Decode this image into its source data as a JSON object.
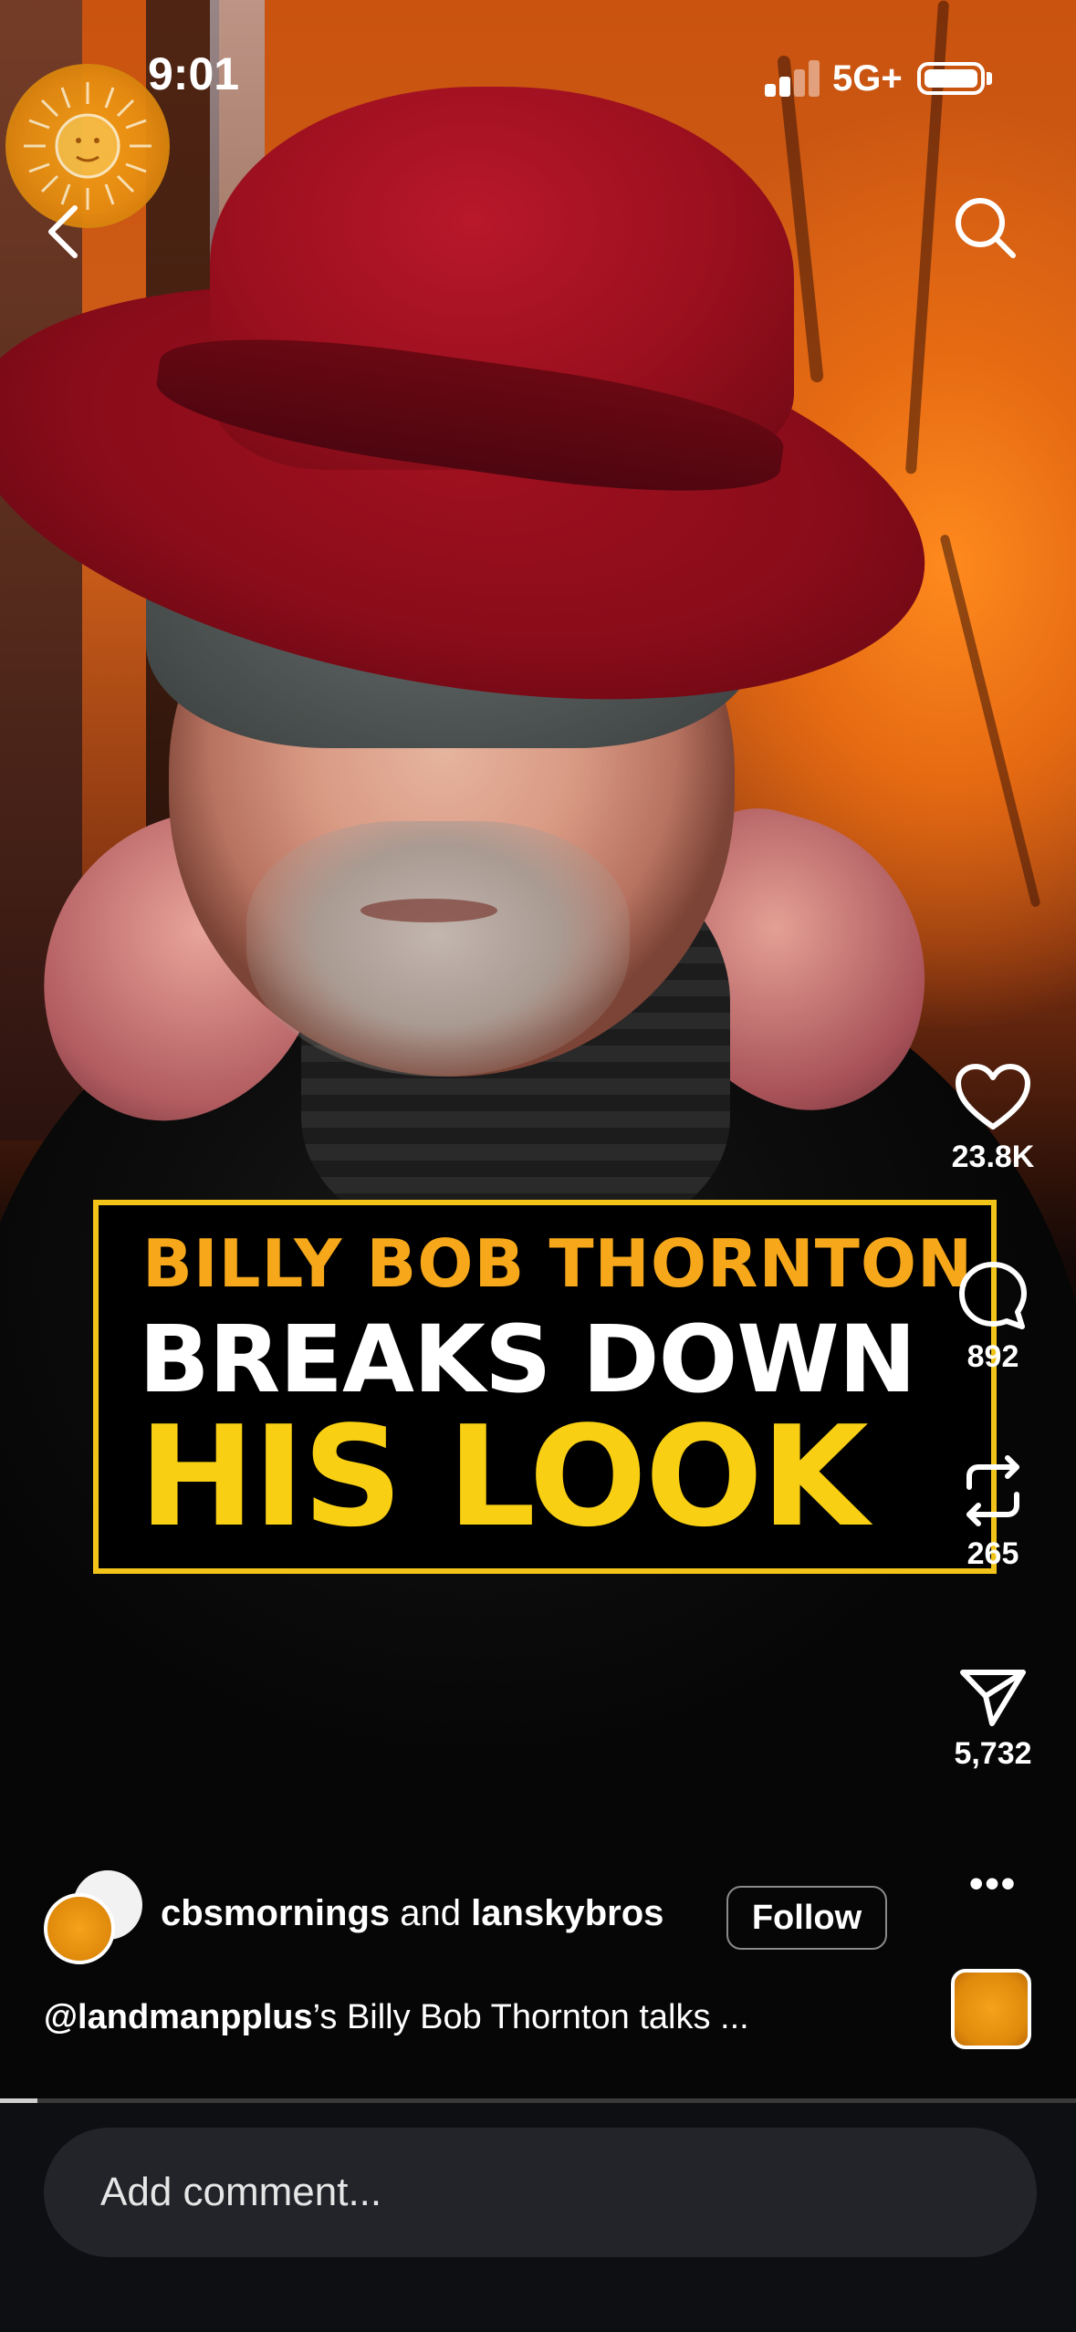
{
  "status_bar": {
    "time": "9:01",
    "network": "5G+"
  },
  "video": {
    "caption": {
      "line1": "BILLY BOB THORNTON",
      "line2": "BREAKS DOWN",
      "line3": "HIS LOOK"
    },
    "progress_fraction": 0.035
  },
  "actions": {
    "likes": "23.8K",
    "comments": "892",
    "reposts": "265",
    "shares": "5,732"
  },
  "post": {
    "author1": "cbsmornings",
    "connector": "and",
    "author2": "lanskybros",
    "follow_label": "Follow",
    "mention": "@landmanpplus",
    "description_rest": "’s Billy Bob Thornton talks ..."
  },
  "comment_bar": {
    "placeholder": "Add comment..."
  },
  "icons": [
    "sun-logo-icon",
    "back-arrow-icon",
    "search-icon",
    "heart-icon",
    "comment-icon",
    "repost-icon",
    "share-icon",
    "more-icon"
  ],
  "colors": {
    "caption_orange": "#f6a81a",
    "caption_yellow": "#f8cf13",
    "caption_border": "#f2c419",
    "brand_orange": "#f6a21a"
  }
}
